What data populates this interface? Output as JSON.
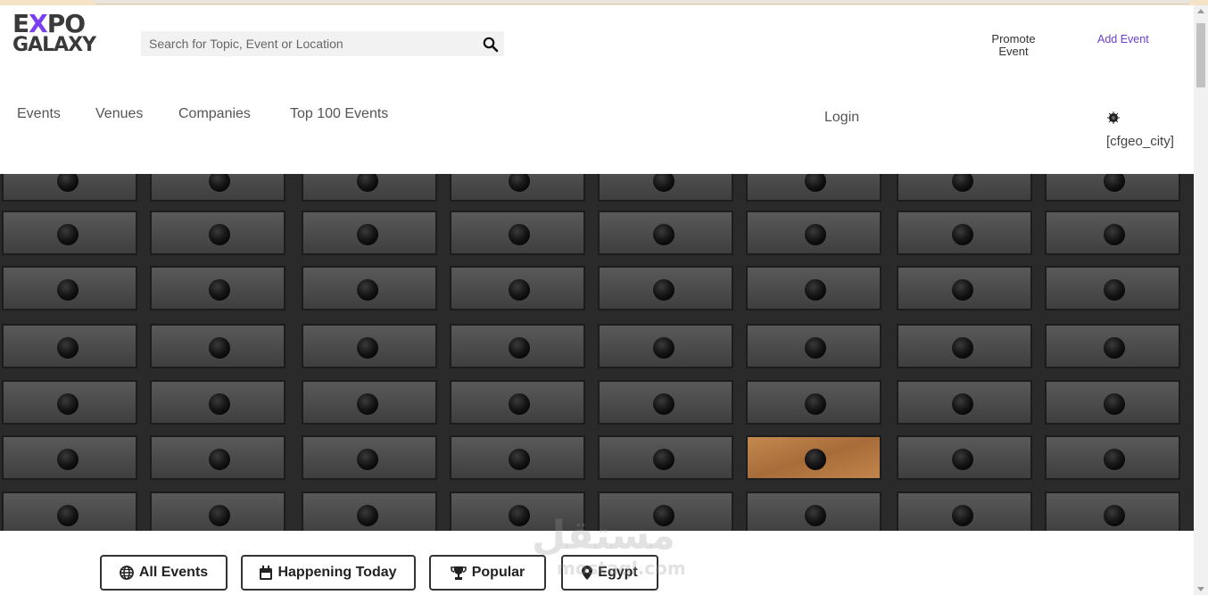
{
  "logo": {
    "line1_a": "E",
    "line1_x": "X",
    "line1_b": "PO",
    "line2": "GALAXY"
  },
  "search": {
    "placeholder": "Search for Topic, Event or Location"
  },
  "header": {
    "promote_line1": "Promote",
    "promote_line2": "Event",
    "add_event": "Add Event"
  },
  "nav": {
    "items": [
      {
        "label": "Events"
      },
      {
        "label": "Venues"
      },
      {
        "label": "Companies"
      },
      {
        "label": "Top 100 Events"
      }
    ],
    "login": "Login",
    "geo_placeholder": "[cfgeo_city]"
  },
  "filters": [
    {
      "label": "All Events",
      "icon": "globe-icon"
    },
    {
      "label": "Happening Today",
      "icon": "calendar-icon"
    },
    {
      "label": "Popular",
      "icon": "trophy-icon"
    },
    {
      "label": "Egypt",
      "icon": "map-marker-icon"
    }
  ],
  "watermark": {
    "arabic": "مستقل",
    "latin": "mostaql.com"
  },
  "colors": {
    "accent": "#6a3fd6",
    "hero_drawer": "#4a4a4a",
    "hero_highlight": "#b07a48"
  }
}
